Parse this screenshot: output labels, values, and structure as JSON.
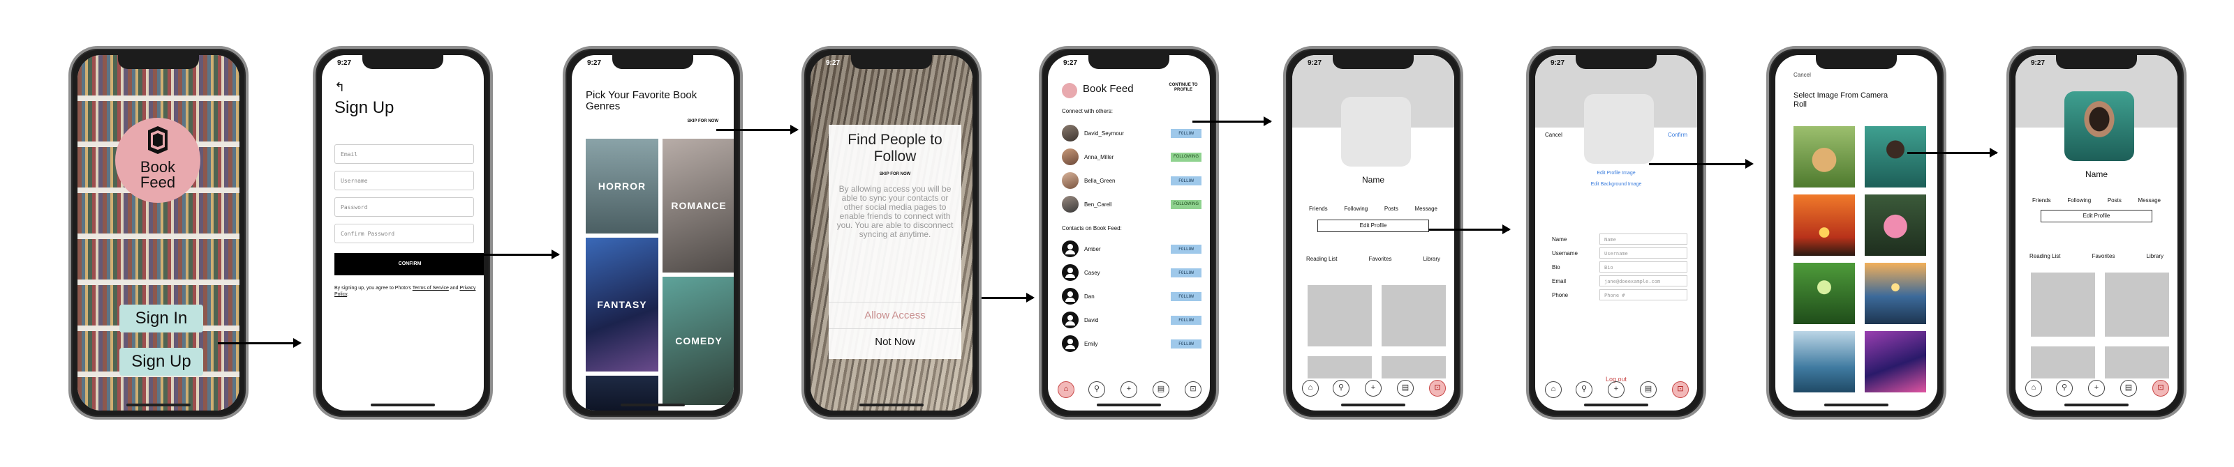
{
  "status_time": "9:27",
  "screen1": {
    "logo_line1": "Book",
    "logo_line2": "Feed",
    "sign_in": "Sign In",
    "sign_up": "Sign Up"
  },
  "screen2": {
    "title": "Sign Up",
    "fields": {
      "email": "Email",
      "username": "Username",
      "password": "Password",
      "confirm_password": "Confirm Password"
    },
    "confirm": "CONFIRM",
    "terms_prefix": "By signing up, you agree to Photo's ",
    "terms_link": "Terms of Service",
    "terms_and": " and ",
    "privacy_link": "Privacy Policy",
    "terms_suffix": "."
  },
  "screen3": {
    "title": "Pick Your Favorite Book Genres",
    "skip": "SKIP FOR NOW",
    "genres": {
      "horror": "HORROR",
      "romance": "ROMANCE",
      "fantasy": "FANTASY",
      "comedy": "COMEDY"
    }
  },
  "screen4": {
    "title": "Find People to Follow",
    "skip": "SKIP FOR NOW",
    "body": "By allowing access you will be able to sync your contacts or other social media pages to enable friends to connect with you. You are able to disconnect syncing at anytime.",
    "allow": "Allow Access",
    "not_now": "Not Now"
  },
  "screen5": {
    "title": "Book Feed",
    "continue": "CONTINUE TO PROFILE",
    "others_header": "Connect with others:",
    "others": [
      {
        "name": "David_Seymour",
        "action": "FOLLOW"
      },
      {
        "name": "Anna_Miller",
        "action": "FOLLOWING"
      },
      {
        "name": "Bella_Green",
        "action": "FOLLOW"
      },
      {
        "name": "Ben_Carell",
        "action": "FOLLOWING"
      }
    ],
    "contacts_header": "Contacts on Book Feed:",
    "contacts": [
      {
        "name": "Amber",
        "action": "FOLLOW"
      },
      {
        "name": "Casey",
        "action": "FOLLOW"
      },
      {
        "name": "Dan",
        "action": "FOLLOW"
      },
      {
        "name": "David",
        "action": "FOLLOW"
      },
      {
        "name": "Emily",
        "action": "FOLLOW"
      }
    ]
  },
  "profile": {
    "name": "Name",
    "stats": [
      "Friends",
      "Following",
      "Posts",
      "Message"
    ],
    "edit": "Edit Profile",
    "tabs": [
      "Reading List",
      "Favorites",
      "Library"
    ]
  },
  "edit_profile": {
    "cancel": "Cancel",
    "confirm": "Confirm",
    "edit_image": "Edit Profile Image",
    "edit_background": "Edit Background Image",
    "fields": [
      {
        "label": "Name",
        "placeholder": "Name"
      },
      {
        "label": "Username",
        "placeholder": "Username"
      },
      {
        "label": "Bio",
        "placeholder": "Bio"
      },
      {
        "label": "Email",
        "placeholder": "jane@doeexample.com"
      },
      {
        "label": "Phone",
        "placeholder": "Phone #"
      }
    ],
    "logout": "Log out"
  },
  "camera_roll": {
    "cancel": "Cancel",
    "title": "Select Image From Camera Roll"
  },
  "tab_icons": [
    "home-icon",
    "search-icon",
    "plus-icon",
    "library-icon",
    "lock-icon"
  ],
  "colors": {
    "accent_pink": "#e8a9ae",
    "follow_blue": "#9ec8ea",
    "following_green": "#8fd28f",
    "button_teal": "#bfe3df",
    "logout_red": "#c94949",
    "link_blue": "#3b7ddd"
  }
}
